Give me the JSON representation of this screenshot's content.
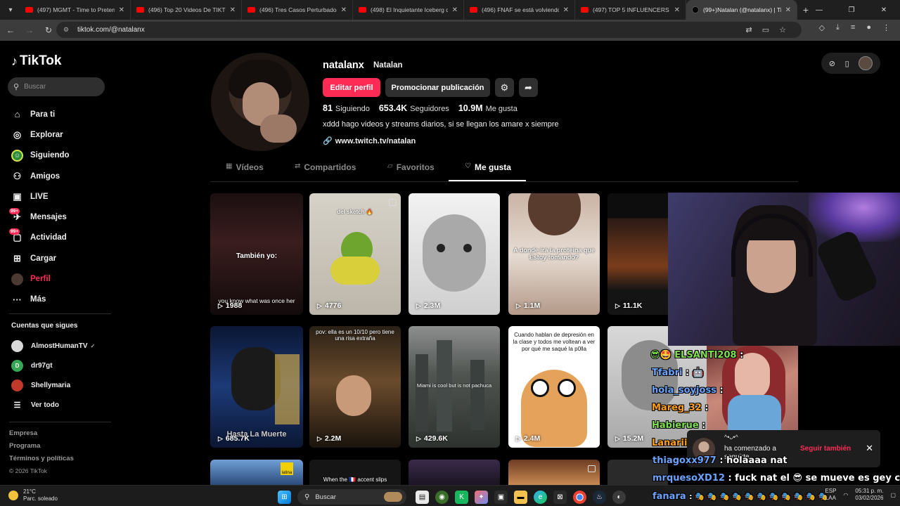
{
  "browser": {
    "tabs": [
      {
        "title": "(497) MGMT - Time to Pretend",
        "icon": "youtube-icon"
      },
      {
        "title": "(496) Top 20 Videos De TIKTOK",
        "icon": "youtube-icon"
      },
      {
        "title": "(496) Tres Casos Perturbadores",
        "icon": "youtube-icon"
      },
      {
        "title": "(498) El Inquietante Iceberg de",
        "icon": "youtube-icon"
      },
      {
        "title": "(496) FNAF se está volviendo R",
        "icon": "youtube-icon"
      },
      {
        "title": "(497) TOP 5 INFLUENCERS QUE",
        "icon": "youtube-icon"
      },
      {
        "title": "(99+)Natalan (@natalanx) | Tik",
        "icon": "tiktok-icon"
      }
    ],
    "url": "tiktok.com/@natalanx"
  },
  "sidebar": {
    "brand": "TikTok",
    "search_placeholder": "Buscar",
    "menu": [
      {
        "label": "Para ti",
        "icon": "home-icon"
      },
      {
        "label": "Explorar",
        "icon": "compass-icon"
      },
      {
        "label": "Siguiendo",
        "icon": "following-icon"
      },
      {
        "label": "Amigos",
        "icon": "friends-icon"
      },
      {
        "label": "LIVE",
        "icon": "live-icon"
      },
      {
        "label": "Mensajes",
        "icon": "messages-icon",
        "badge": "99+"
      },
      {
        "label": "Actividad",
        "icon": "activity-icon",
        "badge": "99+"
      },
      {
        "label": "Cargar",
        "icon": "upload-icon"
      },
      {
        "label": "Perfil",
        "icon": "profile-icon"
      },
      {
        "label": "Más",
        "icon": "more-icon"
      }
    ],
    "following_title": "Cuentas que sigues",
    "following": [
      {
        "name": "AlmostHumanTV",
        "avatar_color": "#d8d8d8"
      },
      {
        "name": "dr97gt",
        "avatar_color": "#34a853",
        "initial": "D"
      },
      {
        "name": "Shellymaria",
        "avatar_color": "#c0392b"
      }
    ],
    "see_all": "Ver todo",
    "footer": [
      "Empresa",
      "Programa",
      "Términos y políticas"
    ],
    "copyright": "© 2026 TikTok"
  },
  "profile": {
    "username": "natalanx",
    "nickname": "Natalan",
    "edit_label": "Editar perfil",
    "promote_label": "Promocionar publicación",
    "stats": [
      {
        "value": "81",
        "label": "Siguiendo"
      },
      {
        "value": "653.4K",
        "label": "Seguidores"
      },
      {
        "value": "10.9M",
        "label": "Me gusta"
      }
    ],
    "bio": "xddd hago videos y streams diarios, si se llegan los amare x siempre",
    "link": "www.twitch.tv/natalan",
    "tabs": [
      "Vídeos",
      "Compartidos",
      "Favoritos",
      "Me gusta"
    ],
    "active_tab": "Me gusta"
  },
  "videos": [
    {
      "views": "1988",
      "caption": "También yo:",
      "caption2": "you know what was once her"
    },
    {
      "views": "4776",
      "caption": "del sketch 🔥"
    },
    {
      "views": "2.3M"
    },
    {
      "views": "1.1M",
      "caption": "A donde irá la proteina que Estoy tomando?"
    },
    {
      "views": "11.1K"
    },
    {
      "views": "685.7K",
      "caption": "Hasta La Muerte"
    },
    {
      "views": "2.2M",
      "caption": "pov: ella es un 10/10 pero tiene una risa extraña"
    },
    {
      "views": "429.6K",
      "caption": "Miami is cool but is not pachuca"
    },
    {
      "views": "2.4M",
      "caption": "Cuando hablan de depresión en la clase y todos me voltean a ver por qué me saqué la p0lla"
    },
    {
      "views": "15.2M"
    }
  ],
  "row3_captions": [
    "latina",
    "When the 🇫🇷 accent slips"
  ],
  "chat": [
    {
      "user": "😎🤩 ELSANTI208",
      "text": ":",
      "color": "#7fe052"
    },
    {
      "user": "Tfabri",
      "text": ": 🤖",
      "color": "#6aa4ff"
    },
    {
      "user": "hola_soyjoss",
      "text": ":",
      "color": "#6aa4ff"
    },
    {
      "user": "Mareg_32",
      "text": ":",
      "color": "#ff9f1a"
    },
    {
      "user": "Habierue",
      "text": ":",
      "color": "#7fe052"
    },
    {
      "user": "Lanarii",
      "text": ":",
      "color": "#ff9f1a"
    },
    {
      "user": "thiagoxx977",
      "text": ": holaaaa nat",
      "color": "#6aa4ff"
    },
    {
      "user": "mrquesoXD12",
      "text": ": fuck nat el 😎 se mueve es gey coño",
      "color": "#6aa4ff"
    },
    {
      "user": "fanara",
      "text": ": 🎭 🎭 🎭 🎭 🎭 🎭 🎭 🎭 🎭 🎭 🎭",
      "color": "#6aa4ff"
    }
  ],
  "notification": {
    "text": "ha comenzado a seguirte",
    "follow_back": "Seguir también",
    "decor": "^•ᴗ•^"
  },
  "taskbar": {
    "temp": "21°C",
    "weather": "Parc. soleado",
    "search_placeholder": "Buscar",
    "lang1": "ESP",
    "lang2": "LAA",
    "time": "05:31 p. m.",
    "date": "03/02/2026"
  },
  "colors": {
    "accent": "#fe2c55",
    "background": "#000000"
  }
}
